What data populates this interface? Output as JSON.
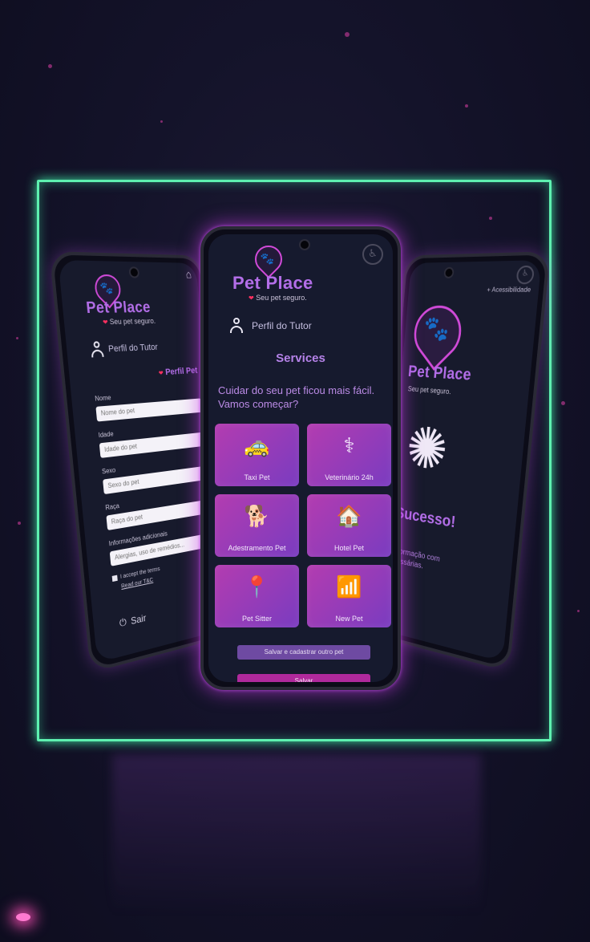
{
  "app": {
    "name": "Pet Place",
    "tagline": "Seu pet seguro.",
    "tagline_right": "Seu pet seguro."
  },
  "colors": {
    "neon_frame": "#5ef0b0",
    "accent_purple": "#b36ee8",
    "tile_gradient_start": "#b33cb0",
    "tile_gradient_end": "#7a3cc0",
    "save_button": "#b0299c",
    "alt_button": "#6e4aa2"
  },
  "center": {
    "profile_label": "Perfil do Tutor",
    "section_title": "Services",
    "welcome_text": "Cuidar do seu pet ficou mais fácil. Vamos começar?",
    "services": [
      {
        "label": "Taxi Pet",
        "icon": "taxi-icon"
      },
      {
        "label": "Veterinário 24h",
        "icon": "stethoscope-icon"
      },
      {
        "label": "Adestramento Pet",
        "icon": "trainer-dog-icon"
      },
      {
        "label": "Hotel Pet",
        "icon": "pet-hotel-icon"
      },
      {
        "label": "Pet Sitter",
        "icon": "map-pin-icon"
      },
      {
        "label": "New Pet",
        "icon": "pet-tag-icon"
      }
    ],
    "alt_button_label": "Salvar e cadastrar outro pet",
    "save_button_label": "Salvar"
  },
  "left": {
    "profile_label": "Perfil do Tutor",
    "section_title": "Perfil Pet",
    "fields": [
      {
        "label": "Nome",
        "placeholder": "Nome do pet"
      },
      {
        "label": "Idade",
        "placeholder": "Idade do pet"
      },
      {
        "label": "Sexo",
        "placeholder": "Sexo do pet"
      },
      {
        "label": "Raça",
        "placeholder": "Raça do pet"
      },
      {
        "label": "Informações adicionais",
        "placeholder": "Alergias, uso de remédios..."
      }
    ],
    "terms_label": "I accept the terms",
    "terms_link": "Read our T&C",
    "exit_label": "Sair"
  },
  "right": {
    "accessibility_label": "Acessibilidade",
    "success_text": "Sucesso!",
    "message_text": "Informação com ...essárias."
  }
}
